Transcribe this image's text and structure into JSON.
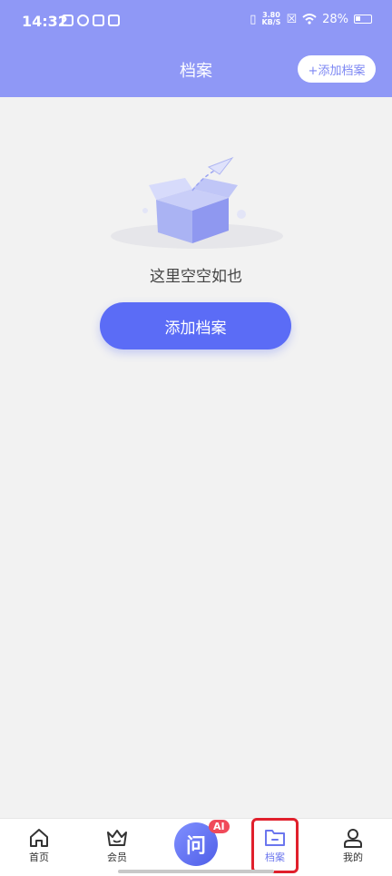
{
  "status_bar": {
    "time": "14:32",
    "net_speed_value": "3.80",
    "net_speed_unit": "KB/S",
    "battery": "28%"
  },
  "header": {
    "title": "档案",
    "add_button": "+添加档案"
  },
  "empty": {
    "message": "这里空空如也",
    "add_button": "添加档案"
  },
  "tabs": [
    {
      "label": "首页",
      "icon": "home-icon"
    },
    {
      "label": "会员",
      "icon": "crown-icon"
    },
    {
      "label": "问",
      "icon": "ai-ask-icon",
      "badge": "AI"
    },
    {
      "label": "档案",
      "icon": "folder-icon",
      "active": true
    },
    {
      "label": "我的",
      "icon": "user-icon"
    }
  ],
  "colors": {
    "header": "#8f98f6",
    "accent": "#5b6cf6",
    "highlight": "#e0202c"
  }
}
